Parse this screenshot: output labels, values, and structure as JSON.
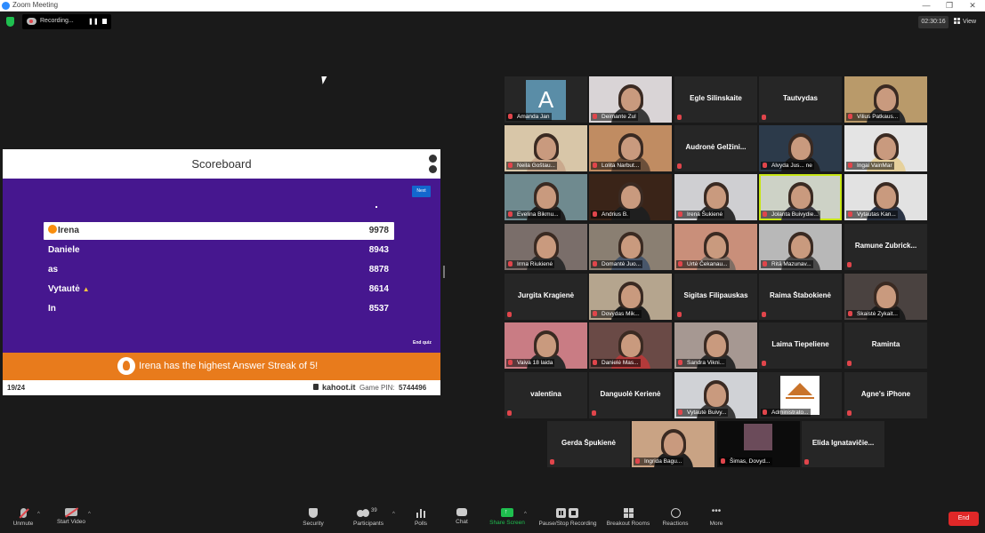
{
  "window": {
    "title": "Zoom Meeting",
    "min": "—",
    "restore": "❐",
    "close": "✕"
  },
  "topbar": {
    "recording_label": "Recording...",
    "pause_glyph": "❚❚",
    "timer": "02:30:16",
    "view_label": "View"
  },
  "share": {
    "header": "Scoreboard",
    "next_label": "Next",
    "end_label": "End quiz",
    "scores": [
      {
        "name": "Irena",
        "score": "9978"
      },
      {
        "name": "Daniele",
        "score": "8943"
      },
      {
        "name": "as",
        "score": "8878"
      },
      {
        "name": "Vytautė",
        "score": "8614"
      },
      {
        "name": "In",
        "score": "8537"
      }
    ],
    "streak_message": "Irena has the highest Answer Streak of 5!",
    "progress": "19/24",
    "site": "kahoot.it",
    "pin_label": "Game PIN:",
    "pin": "5744496"
  },
  "gallery": {
    "rows": [
      [
        {
          "label": "Amanda Jan",
          "kind": "avatar",
          "initial": "A"
        },
        {
          "label": "Deimante Zul",
          "kind": "video",
          "bg": "#d9d4d6",
          "shirt": "#3a3a3a"
        },
        {
          "label": "Egle Silinskaite",
          "kind": "name"
        },
        {
          "label": "Tautvydas",
          "kind": "name"
        },
        {
          "label": "Vilius Patkaus...",
          "kind": "video",
          "bg": "#b99a6a",
          "shirt": "#2b2b2b"
        }
      ],
      [
        {
          "label": "Neila Goštau...",
          "kind": "video",
          "bg": "#d8c6a8",
          "shirt": "#caa98d"
        },
        {
          "label": "Lolita Narbut...",
          "kind": "video",
          "bg": "#c08c62",
          "shirt": "#6b4f3a"
        },
        {
          "label": "Audronė Gelžini...",
          "kind": "name"
        },
        {
          "label": "Alvyda Jus... ne",
          "kind": "video",
          "bg": "#2c3a4a",
          "shirt": "#1a1a1a"
        },
        {
          "label": "Ingai VainMar",
          "kind": "video",
          "bg": "#e4e4e4",
          "shirt": "#e6d19c"
        }
      ],
      [
        {
          "label": "Evelina Bikmu...",
          "kind": "video",
          "bg": "#6f8a8f",
          "shirt": "#1f1f1f"
        },
        {
          "label": "Andrius B.",
          "kind": "video",
          "bg": "#3a2418",
          "shirt": "#1f1f1f"
        },
        {
          "label": "Irena Šukienė",
          "kind": "video",
          "bg": "#cfcfd2",
          "shirt": "#2e2e2e"
        },
        {
          "label": "Jolanta Buivydie...",
          "kind": "video",
          "bg": "#cdd2c6",
          "shirt": "#3c3c44",
          "active": true
        },
        {
          "label": "Vytautas Kan...",
          "kind": "video",
          "bg": "#e2e2e2",
          "shirt": "#2a3344"
        }
      ],
      [
        {
          "label": "Irma Riukienė",
          "kind": "video",
          "bg": "#7a6e6a",
          "shirt": "#2c2c2c"
        },
        {
          "label": "Domantė Juo...",
          "kind": "video",
          "bg": "#8a7f72",
          "shirt": "#48566a"
        },
        {
          "label": "Urtė Čekanau...",
          "kind": "video",
          "bg": "#c98f7a",
          "shirt": "#7e6e64"
        },
        {
          "label": "Ritā Mazunav...",
          "kind": "video",
          "bg": "#b8b8b8",
          "shirt": "#4a4a4a"
        },
        {
          "label": "Ramune Zubrick...",
          "kind": "name"
        }
      ],
      [
        {
          "label": "Jurgita Kragienė",
          "kind": "name"
        },
        {
          "label": "Dovydas Mik...",
          "kind": "video",
          "bg": "#b5a58e",
          "shirt": "#1e1e1e"
        },
        {
          "label": "Sigitas Filipauskas",
          "kind": "name"
        },
        {
          "label": "Raima Štabokienė",
          "kind": "name"
        },
        {
          "label": "Skaistė Zykait...",
          "kind": "video",
          "bg": "#4a4240",
          "shirt": "#1c1c1c"
        }
      ],
      [
        {
          "label": "Vaiva 18 laida",
          "kind": "video",
          "bg": "#c97c84",
          "shirt": "#2a2a2a"
        },
        {
          "label": "Danielė Mas...",
          "kind": "video",
          "bg": "#6a4a46",
          "shirt": "#b23a3a"
        },
        {
          "label": "Sandra Vikni...",
          "kind": "video",
          "bg": "#a69892",
          "shirt": "#2a2a2a"
        },
        {
          "label": "Laima Tiepeliene",
          "kind": "name"
        },
        {
          "label": "Raminta",
          "kind": "name"
        }
      ],
      [
        {
          "label": "valentina",
          "kind": "name"
        },
        {
          "label": "Danguolė Kerienė",
          "kind": "name"
        },
        {
          "label": "Vytautė Buivy...",
          "kind": "video",
          "bg": "#d0d2d6",
          "shirt": "#3a3a3a"
        },
        {
          "label": "Administrato...",
          "kind": "logo"
        },
        {
          "label": "Agne's iPhone",
          "kind": "name"
        }
      ],
      [
        {
          "label": "Gerda Špukienė",
          "kind": "name"
        },
        {
          "label": "Ingrida Bagu...",
          "kind": "video",
          "bg": "#c9a384",
          "shirt": "#1f1f1f"
        },
        {
          "label": "Šimas, Dovyd...",
          "kind": "poster"
        },
        {
          "label": "Elida Ignatavičie...",
          "kind": "name"
        }
      ]
    ]
  },
  "toolbar": {
    "unmute": "Unmute",
    "start_video": "Start Video",
    "security": "Security",
    "participants": "Participants",
    "participants_count": "39",
    "polls": "Polls",
    "chat": "Chat",
    "share_screen": "Share Screen",
    "pause_stop": "Pause/Stop Recording",
    "breakout": "Breakout Rooms",
    "reactions": "Reactions",
    "more": "More",
    "end": "End"
  },
  "colors": {
    "kahoot_purple": "#46178f",
    "kahoot_orange": "#e87b1c",
    "active_speaker": "#c8e614",
    "share_green": "#1fbf4f",
    "end_red": "#e02828"
  }
}
